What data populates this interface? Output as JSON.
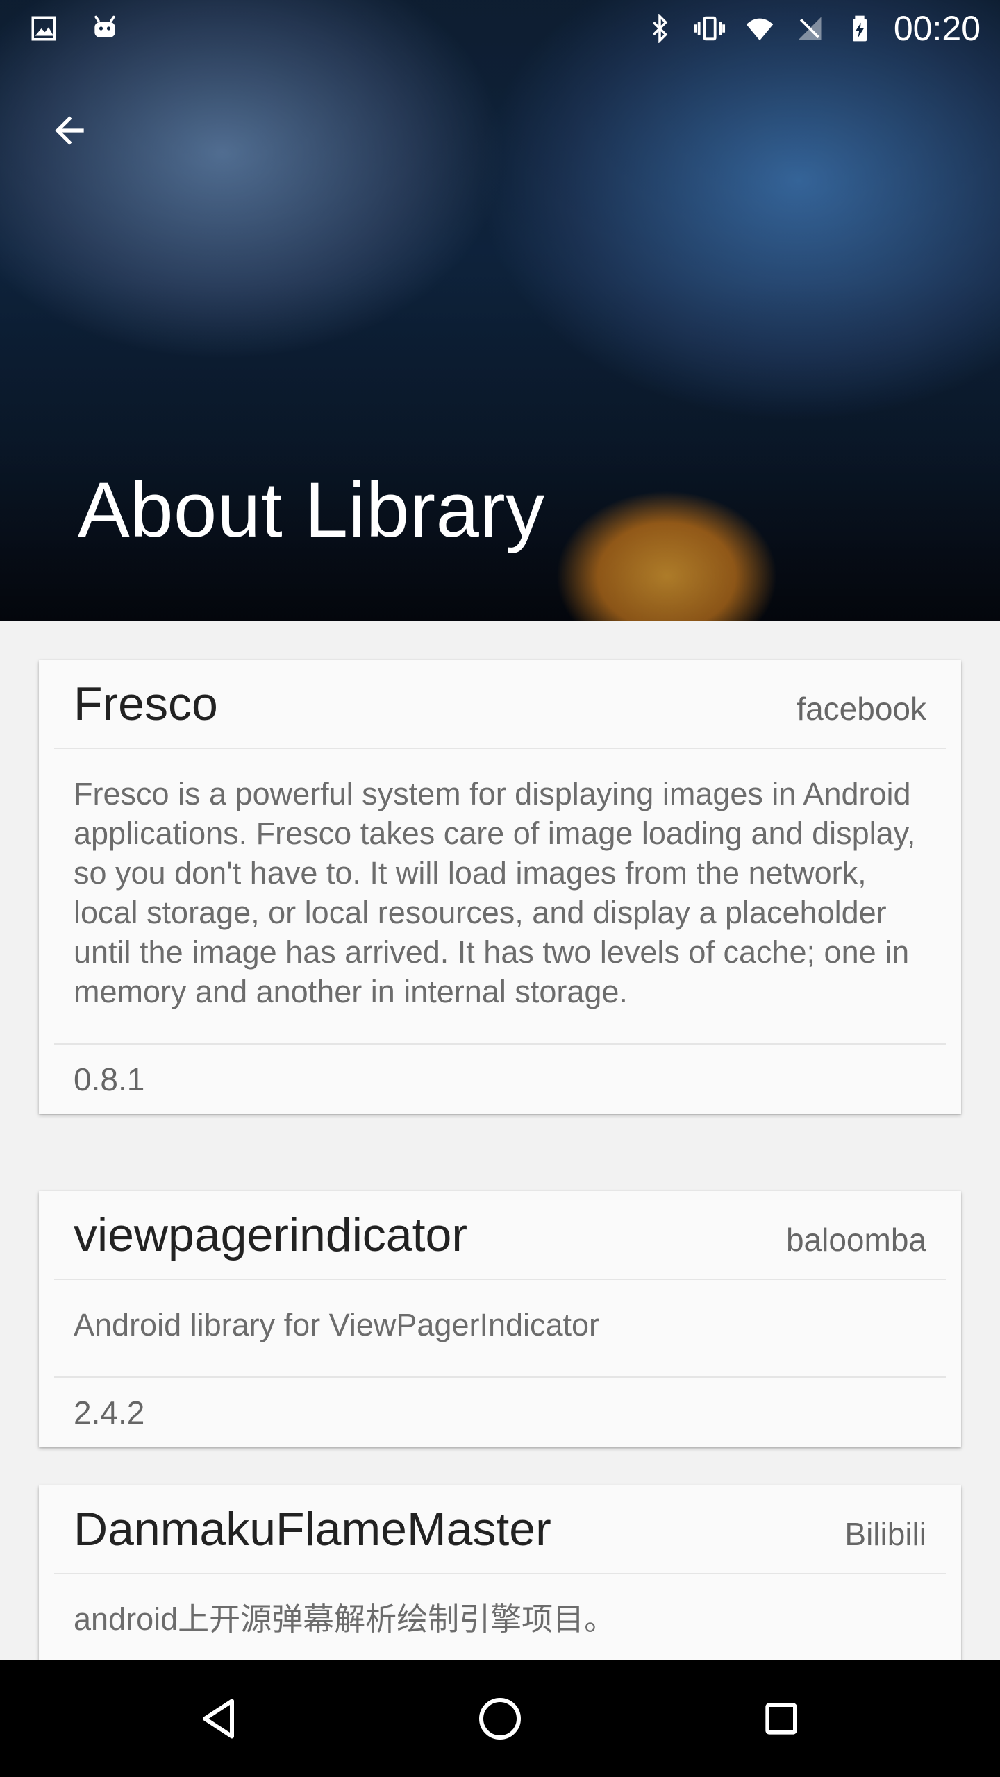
{
  "status_bar": {
    "time": "00:20",
    "left_icons": [
      "image-icon",
      "android-icon"
    ],
    "right_icons": [
      "bluetooth-icon",
      "vibrate-icon",
      "wifi-icon",
      "no-signal-icon",
      "battery-charging-icon"
    ]
  },
  "header": {
    "title": "About Library",
    "back_icon": "arrow-back-icon"
  },
  "libraries": [
    {
      "name": "Fresco",
      "author": "facebook",
      "description": "Fresco is a powerful system for displaying images in Android applications. Fresco takes care of image loading and display, so you don't have to. It will load images from the network, local storage, or local resources, and display a placeholder until the image has arrived. It has two levels of cache; one in memory and another in internal storage.",
      "version": "0.8.1"
    },
    {
      "name": "viewpagerindicator",
      "author": "baloomba",
      "description": "Android library for ViewPagerIndicator",
      "version": "2.4.2"
    },
    {
      "name": "DanmakuFlameMaster",
      "author": "Bilibili",
      "description": "android上开源弹幕解析绘制引擎项目。",
      "version": ""
    }
  ],
  "nav_bar": {
    "back": "back-triangle-icon",
    "home": "home-circle-icon",
    "recents": "recents-square-icon"
  },
  "colors": {
    "background": "#f2f2f2",
    "card": "#fafafa",
    "title_text": "#222222",
    "secondary_text": "#6c6c6c",
    "nav_bar": "#000000"
  }
}
